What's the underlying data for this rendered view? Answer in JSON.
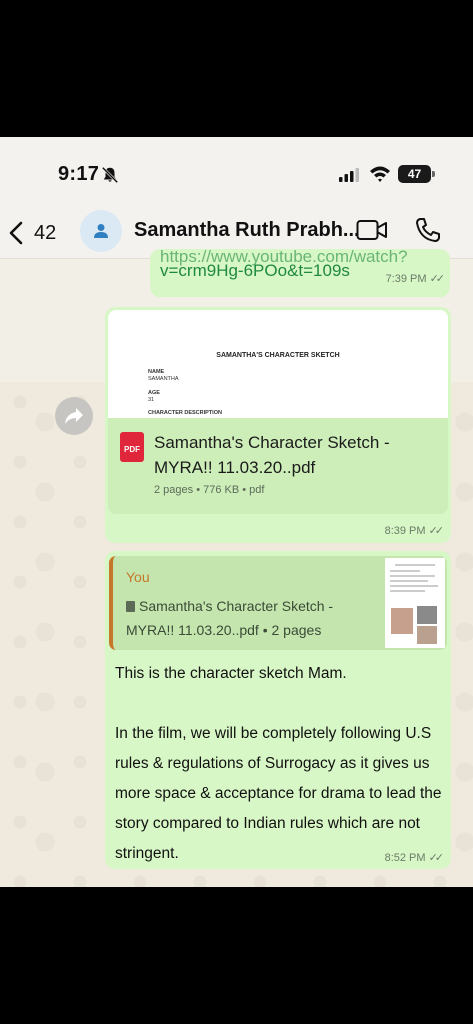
{
  "status_bar": {
    "time": "9:17",
    "battery": "47"
  },
  "header": {
    "back_count": "42",
    "contact_name": "Samantha Ruth Prabh..."
  },
  "messages": {
    "link": {
      "partial_url": "https://www.youtube.com/watch?",
      "text": "v=crm9Hg-6POo&t=109s",
      "time": "7:39 PM"
    },
    "document": {
      "preview_title": "SAMANTHA'S CHARACTER SKETCH",
      "preview_name_label": "NAME",
      "preview_name": "SAMANTHA",
      "preview_age_label": "AGE",
      "preview_age": "31",
      "preview_desc_label": "CHARACTER DESCRIPTION",
      "pdf_label": "PDF",
      "file_name": "Samantha's Character Sketch - MYRA!! 11.03.20..pdf",
      "meta": "2 pages • 776 KB • pdf",
      "time": "8:39 PM"
    },
    "reply": {
      "quote_author": "You",
      "quote_text": "Samantha's Character Sketch - MYRA!! 11.03.20..pdf • 2 pages",
      "paragraph1": "This is the character sketch Mam.",
      "paragraph2": "In the film, we will be completely following U.S rules & regulations of Surrogacy as it gives us more space & acceptance for drama to lead the story compared to Indian rules which are not stringent.",
      "time": "8:52 PM"
    }
  },
  "colors": {
    "bubble": "#d8f7c6",
    "link": "#1f8a3f",
    "quote_accent": "#c5772b",
    "pdf_red": "#e0263a"
  }
}
